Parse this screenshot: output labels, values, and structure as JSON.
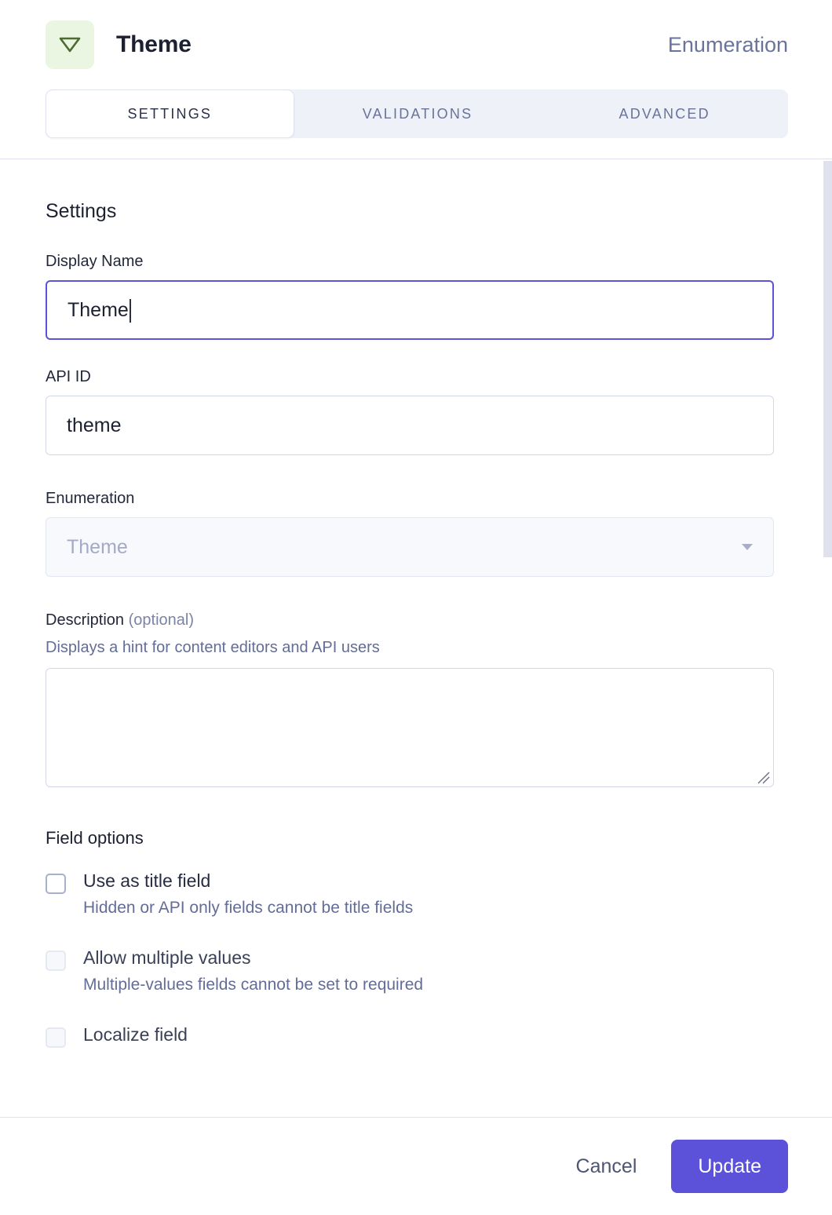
{
  "header": {
    "icon_name": "enumeration-triangle-icon",
    "icon_bg": "#eaf6e2",
    "icon_color": "#4c6b33",
    "title": "Theme",
    "kind": "Enumeration"
  },
  "tabs": [
    {
      "label": "SETTINGS",
      "active": true
    },
    {
      "label": "VALIDATIONS",
      "active": false
    },
    {
      "label": "ADVANCED",
      "active": false
    }
  ],
  "settings": {
    "section_title": "Settings",
    "display_name": {
      "label": "Display Name",
      "value": "Theme",
      "focused": true
    },
    "api_id": {
      "label": "API ID",
      "value": "theme"
    },
    "enumeration": {
      "label": "Enumeration",
      "value": "Theme",
      "disabled": true,
      "caret_icon": "chevron-down-icon"
    },
    "description": {
      "label": "Description",
      "optional_suffix": "(optional)",
      "hint": "Displays a hint for content editors and API users",
      "value": "",
      "placeholder": ""
    }
  },
  "field_options": {
    "title": "Field options",
    "items": [
      {
        "label": "Use as title field",
        "description": "Hidden or API only fields cannot be title fields",
        "checked": false,
        "disabled": false
      },
      {
        "label": "Allow multiple values",
        "description": "Multiple-values fields cannot be set to required",
        "checked": false,
        "disabled": true
      },
      {
        "label": "Localize field",
        "description": "",
        "checked": false,
        "disabled": true
      }
    ]
  },
  "footer": {
    "cancel_label": "Cancel",
    "update_label": "Update",
    "accent_color": "#5b52d9"
  }
}
